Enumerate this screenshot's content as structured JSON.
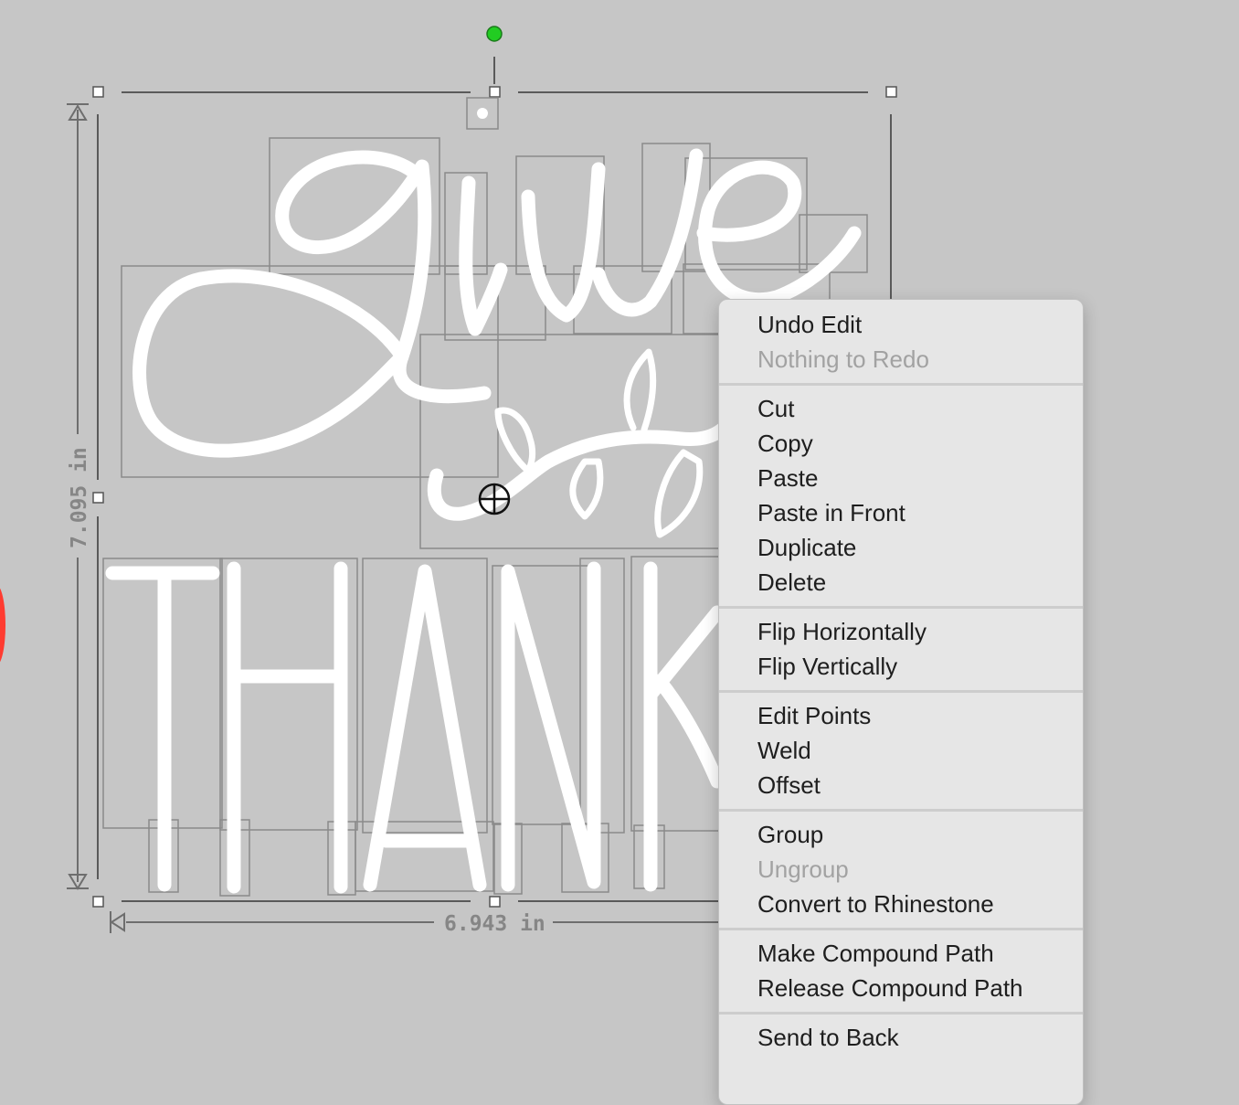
{
  "dimensions": {
    "height_label": "7.095 in",
    "width_label": "6.943 in"
  },
  "design": {
    "script_text": "give",
    "block_text": "THANK"
  },
  "context_menu": {
    "groups": [
      [
        {
          "label": "Undo Edit",
          "enabled": true
        },
        {
          "label": "Nothing to Redo",
          "enabled": false
        }
      ],
      [
        {
          "label": "Cut",
          "enabled": true
        },
        {
          "label": "Copy",
          "enabled": true
        },
        {
          "label": "Paste",
          "enabled": true
        },
        {
          "label": "Paste in Front",
          "enabled": true
        },
        {
          "label": "Duplicate",
          "enabled": true
        },
        {
          "label": "Delete",
          "enabled": true
        }
      ],
      [
        {
          "label": "Flip Horizontally",
          "enabled": true
        },
        {
          "label": "Flip Vertically",
          "enabled": true
        }
      ],
      [
        {
          "label": "Edit Points",
          "enabled": true
        },
        {
          "label": "Weld",
          "enabled": true
        },
        {
          "label": "Offset",
          "enabled": true
        }
      ],
      [
        {
          "label": "Group",
          "enabled": true
        },
        {
          "label": "Ungroup",
          "enabled": false
        },
        {
          "label": "Convert to Rhinestone",
          "enabled": true
        }
      ],
      [
        {
          "label": "Make Compound Path",
          "enabled": true
        },
        {
          "label": "Release Compound Path",
          "enabled": true
        }
      ],
      [
        {
          "label": "Send to Back",
          "enabled": true
        }
      ]
    ]
  },
  "colors": {
    "canvas_bg": "#c6c6c6",
    "rotation_handle": "#22cc22",
    "design_stroke": "#ffffff",
    "menu_bg": "#e6e6e6"
  }
}
